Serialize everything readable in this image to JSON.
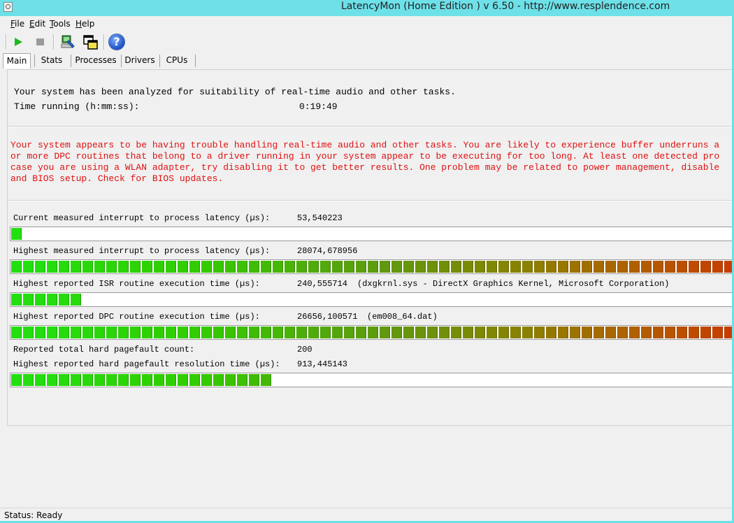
{
  "window": {
    "title": "LatencyMon  (Home Edition )  v 6.50 - http://www.resplendence.com"
  },
  "menu": [
    "File",
    "Edit",
    "Tools",
    "Help"
  ],
  "toolbar": {
    "buttons": [
      "play-icon",
      "stop-icon",
      "monitor-icon",
      "windows-icon",
      "help-icon"
    ],
    "help_glyph": "?"
  },
  "tabs": [
    "Main",
    "Stats",
    "Processes",
    "Drivers",
    "CPUs"
  ],
  "summary": {
    "line1": "Your system has been analyzed for suitability of real-time audio and other tasks.",
    "time_label": "Time running (h:mm:ss):",
    "time_value": "0:19:49"
  },
  "warning": {
    "lines": [
      "Your system appears to be having trouble handling real-time audio and other tasks. You are likely to experience buffer underruns a",
      "or more DPC routines that belong to a driver running in your system appear to be executing for too long. At least one detected pro",
      "case you are using a WLAN adapter, try disabling it to get better results. One problem may be related to power management, disable",
      "and BIOS setup. Check for BIOS updates."
    ],
    "color": "#e01010"
  },
  "metrics": {
    "current_latency": {
      "label": "Current measured interrupt to process latency (µs):",
      "value": "53,540223",
      "level": 0.014
    },
    "highest_latency": {
      "label": "Highest measured interrupt to process latency (µs):",
      "value": "28074,678956",
      "level": 1.0
    },
    "isr": {
      "label": "Highest reported ISR routine execution time (µs):",
      "value": "240,555714",
      "detail": "(dxgkrnl.sys - DirectX Graphics Kernel, Microsoft Corporation)",
      "level": 0.096
    },
    "dpc": {
      "label": "Highest reported DPC routine execution time (µs):",
      "value": "26656,100571",
      "detail": "(em008_64.dat)",
      "level": 1.0
    },
    "pagefault_count": {
      "label": "Reported total hard pagefault count:",
      "value": "200"
    },
    "pagefault_time": {
      "label": "Highest reported hard pagefault resolution time (µs):",
      "value": "913,445143",
      "level": 0.355
    }
  },
  "status": {
    "text": "Status: Ready"
  }
}
